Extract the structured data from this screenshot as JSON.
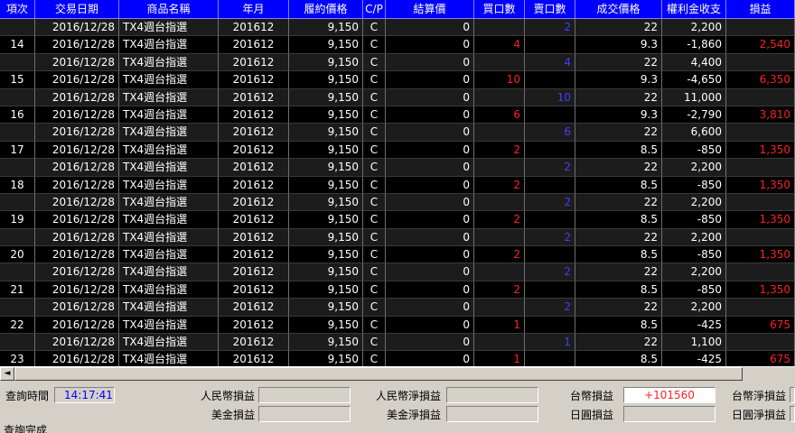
{
  "grid": {
    "columns": [
      "項次",
      "交易日期",
      "商品名稱",
      "年月",
      "履約價格",
      "C/P",
      "結算價",
      "買口數",
      "賣口數",
      "成交價格",
      "權利金收支",
      "損益"
    ],
    "rows": [
      {
        "no": "",
        "date": "2016/12/28",
        "product": "TX4週台指選",
        "ym": "201612",
        "strike": "9,150",
        "cp": "C",
        "settle": "0",
        "buy": "",
        "sell": "2",
        "price": "22",
        "premium": "2,200",
        "pnl": ""
      },
      {
        "no": "14",
        "date": "2016/12/28",
        "product": "TX4週台指選",
        "ym": "201612",
        "strike": "9,150",
        "cp": "C",
        "settle": "0",
        "buy": "4",
        "sell": "",
        "price": "9.3",
        "premium": "-1,860",
        "pnl": "2,540"
      },
      {
        "no": "",
        "date": "2016/12/28",
        "product": "TX4週台指選",
        "ym": "201612",
        "strike": "9,150",
        "cp": "C",
        "settle": "0",
        "buy": "",
        "sell": "4",
        "price": "22",
        "premium": "4,400",
        "pnl": ""
      },
      {
        "no": "15",
        "date": "2016/12/28",
        "product": "TX4週台指選",
        "ym": "201612",
        "strike": "9,150",
        "cp": "C",
        "settle": "0",
        "buy": "10",
        "sell": "",
        "price": "9.3",
        "premium": "-4,650",
        "pnl": "6,350"
      },
      {
        "no": "",
        "date": "2016/12/28",
        "product": "TX4週台指選",
        "ym": "201612",
        "strike": "9,150",
        "cp": "C",
        "settle": "0",
        "buy": "",
        "sell": "10",
        "price": "22",
        "premium": "11,000",
        "pnl": ""
      },
      {
        "no": "16",
        "date": "2016/12/28",
        "product": "TX4週台指選",
        "ym": "201612",
        "strike": "9,150",
        "cp": "C",
        "settle": "0",
        "buy": "6",
        "sell": "",
        "price": "9.3",
        "premium": "-2,790",
        "pnl": "3,810"
      },
      {
        "no": "",
        "date": "2016/12/28",
        "product": "TX4週台指選",
        "ym": "201612",
        "strike": "9,150",
        "cp": "C",
        "settle": "0",
        "buy": "",
        "sell": "6",
        "price": "22",
        "premium": "6,600",
        "pnl": ""
      },
      {
        "no": "17",
        "date": "2016/12/28",
        "product": "TX4週台指選",
        "ym": "201612",
        "strike": "9,150",
        "cp": "C",
        "settle": "0",
        "buy": "2",
        "sell": "",
        "price": "8.5",
        "premium": "-850",
        "pnl": "1,350"
      },
      {
        "no": "",
        "date": "2016/12/28",
        "product": "TX4週台指選",
        "ym": "201612",
        "strike": "9,150",
        "cp": "C",
        "settle": "0",
        "buy": "",
        "sell": "2",
        "price": "22",
        "premium": "2,200",
        "pnl": ""
      },
      {
        "no": "18",
        "date": "2016/12/28",
        "product": "TX4週台指選",
        "ym": "201612",
        "strike": "9,150",
        "cp": "C",
        "settle": "0",
        "buy": "2",
        "sell": "",
        "price": "8.5",
        "premium": "-850",
        "pnl": "1,350"
      },
      {
        "no": "",
        "date": "2016/12/28",
        "product": "TX4週台指選",
        "ym": "201612",
        "strike": "9,150",
        "cp": "C",
        "settle": "0",
        "buy": "",
        "sell": "2",
        "price": "22",
        "premium": "2,200",
        "pnl": ""
      },
      {
        "no": "19",
        "date": "2016/12/28",
        "product": "TX4週台指選",
        "ym": "201612",
        "strike": "9,150",
        "cp": "C",
        "settle": "0",
        "buy": "2",
        "sell": "",
        "price": "8.5",
        "premium": "-850",
        "pnl": "1,350"
      },
      {
        "no": "",
        "date": "2016/12/28",
        "product": "TX4週台指選",
        "ym": "201612",
        "strike": "9,150",
        "cp": "C",
        "settle": "0",
        "buy": "",
        "sell": "2",
        "price": "22",
        "premium": "2,200",
        "pnl": ""
      },
      {
        "no": "20",
        "date": "2016/12/28",
        "product": "TX4週台指選",
        "ym": "201612",
        "strike": "9,150",
        "cp": "C",
        "settle": "0",
        "buy": "2",
        "sell": "",
        "price": "8.5",
        "premium": "-850",
        "pnl": "1,350"
      },
      {
        "no": "",
        "date": "2016/12/28",
        "product": "TX4週台指選",
        "ym": "201612",
        "strike": "9,150",
        "cp": "C",
        "settle": "0",
        "buy": "",
        "sell": "2",
        "price": "22",
        "premium": "2,200",
        "pnl": ""
      },
      {
        "no": "21",
        "date": "2016/12/28",
        "product": "TX4週台指選",
        "ym": "201612",
        "strike": "9,150",
        "cp": "C",
        "settle": "0",
        "buy": "2",
        "sell": "",
        "price": "8.5",
        "premium": "-850",
        "pnl": "1,350"
      },
      {
        "no": "",
        "date": "2016/12/28",
        "product": "TX4週台指選",
        "ym": "201612",
        "strike": "9,150",
        "cp": "C",
        "settle": "0",
        "buy": "",
        "sell": "2",
        "price": "22",
        "premium": "2,200",
        "pnl": ""
      },
      {
        "no": "22",
        "date": "2016/12/28",
        "product": "TX4週台指選",
        "ym": "201612",
        "strike": "9,150",
        "cp": "C",
        "settle": "0",
        "buy": "1",
        "sell": "",
        "price": "8.5",
        "premium": "-425",
        "pnl": "675"
      },
      {
        "no": "",
        "date": "2016/12/28",
        "product": "TX4週台指選",
        "ym": "201612",
        "strike": "9,150",
        "cp": "C",
        "settle": "0",
        "buy": "",
        "sell": "1",
        "price": "22",
        "premium": "1,100",
        "pnl": ""
      },
      {
        "no": "23",
        "date": "2016/12/28",
        "product": "TX4週台指選",
        "ym": "201612",
        "strike": "9,150",
        "cp": "C",
        "settle": "0",
        "buy": "1",
        "sell": "",
        "price": "8.5",
        "premium": "-425",
        "pnl": "675"
      }
    ]
  },
  "scrollbar": {
    "left_arrow": "◄"
  },
  "summary": {
    "query_time_label": "查詢時間",
    "query_time": "14:17:41",
    "rmb_pnl_label": "人民幣損益",
    "rmb_pnl": "",
    "rmb_net_label": "人民幣淨損益",
    "rmb_net": "",
    "twd_pnl_label": "台幣損益",
    "twd_pnl": "+101560",
    "twd_net_label": "台幣淨損益",
    "twd_net": "",
    "usd_pnl_label": "美金損益",
    "usd_pnl": "",
    "usd_net_label": "美金淨損益",
    "usd_net": "",
    "jpy_pnl_label": "日圓損益",
    "jpy_pnl": "",
    "jpy_net_label": "日圓淨損益",
    "jpy_net": ""
  },
  "status": "查詢完成",
  "colors": {
    "header_bg": "#0000ff",
    "buy": "#ff2020",
    "sell": "#4040ff",
    "pnl": "#ff2020",
    "query_time": "#0000ff"
  }
}
